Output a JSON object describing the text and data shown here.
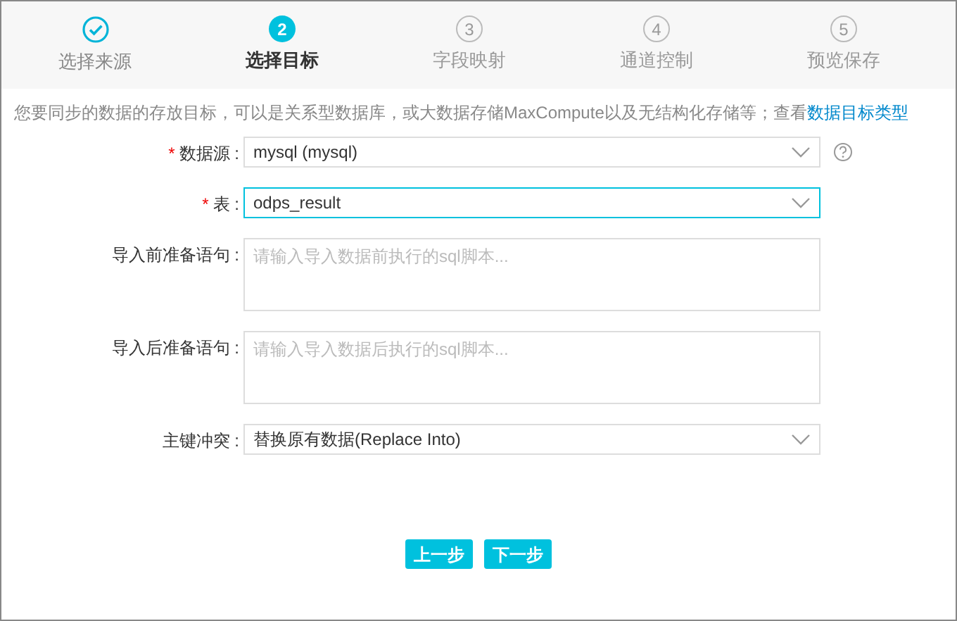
{
  "steps": [
    {
      "label": "选择来源",
      "completed": true,
      "selected": false
    },
    {
      "number": "2",
      "label": "选择目标",
      "completed": false,
      "selected": true
    },
    {
      "number": "3",
      "label": "字段映射",
      "completed": false,
      "selected": false
    },
    {
      "number": "4",
      "label": "通道控制",
      "completed": false,
      "selected": false
    },
    {
      "number": "5",
      "label": "预览保存",
      "completed": false,
      "selected": false
    }
  ],
  "intro": {
    "text": "您要同步的数据的存放目标，可以是关系型数据库，或大数据存储MaxCompute以及无结构化存储等；查看",
    "link": "数据目标类型"
  },
  "fields": [
    {
      "kind": "select",
      "required_mark": "*",
      "label": "数据源 :",
      "value": "mysql (mysql)",
      "focused": false,
      "help": true
    },
    {
      "kind": "select",
      "required_mark": "*",
      "label": "表 :",
      "value": "odps_result",
      "focused": true,
      "help": false
    },
    {
      "kind": "textarea",
      "label": "导入前准备语句 :",
      "placeholder": "请输入导入数据前执行的sql脚本..."
    },
    {
      "kind": "textarea",
      "label": "导入后准备语句 :",
      "placeholder": "请输入导入数据后执行的sql脚本..."
    },
    {
      "kind": "select",
      "label": "主键冲突 :",
      "value": "替换原有数据(Replace Into)",
      "focused": false,
      "help": false
    }
  ],
  "buttons": [
    "上一步",
    "下一步"
  ]
}
